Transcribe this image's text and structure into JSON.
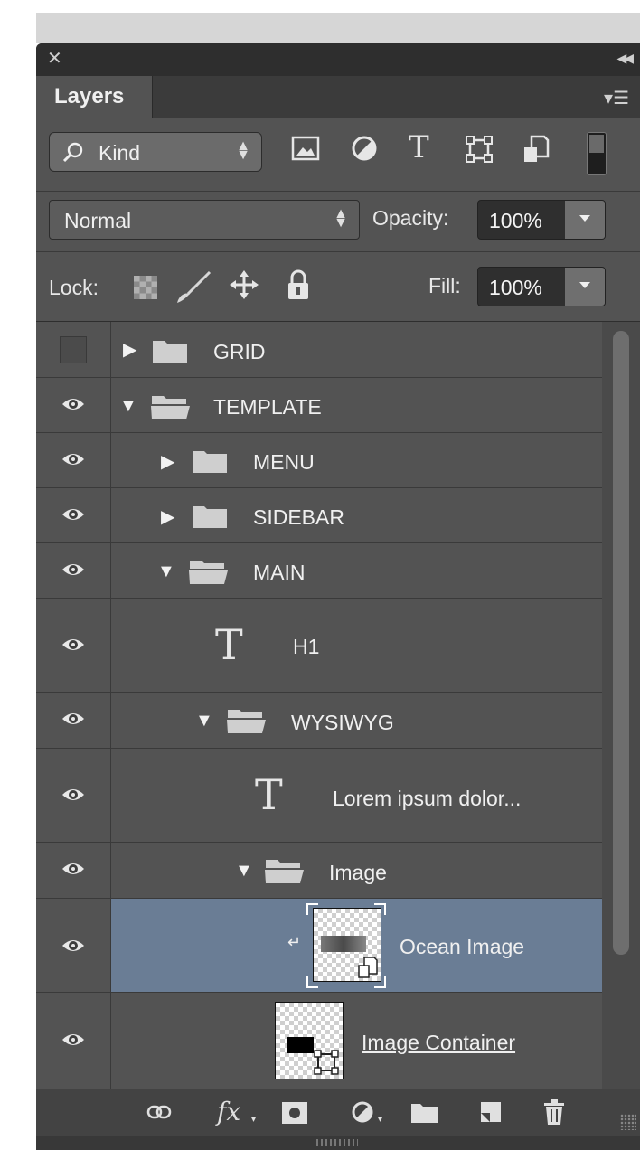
{
  "panel": {
    "close_icon": "close-icon",
    "collapse_icon": "double-chevron-left-icon",
    "tab_label": "Layers",
    "menu_icon": "panel-menu-icon"
  },
  "filter": {
    "kind_label": "Kind",
    "icons": [
      "image-filter-icon",
      "adjustment-filter-icon",
      "type-filter-icon",
      "shape-filter-icon",
      "smart-object-filter-icon"
    ],
    "type_filter_glyph": "T",
    "filter_toggle": "on-off-toggle"
  },
  "blend": {
    "mode": "Normal",
    "opacity_label": "Opacity:",
    "opacity_value": "100%",
    "lock_label": "Lock:",
    "fill_label": "Fill:",
    "fill_value": "100%"
  },
  "layers": [
    {
      "name": "GRID",
      "kind": "group",
      "expanded": false,
      "visible": false
    },
    {
      "name": "TEMPLATE",
      "kind": "group",
      "expanded": true,
      "visible": true
    },
    {
      "name": "MENU",
      "kind": "group",
      "expanded": false,
      "visible": true
    },
    {
      "name": "SIDEBAR",
      "kind": "group",
      "expanded": false,
      "visible": true
    },
    {
      "name": "MAIN",
      "kind": "group",
      "expanded": true,
      "visible": true
    },
    {
      "name": "H1",
      "kind": "text",
      "glyph": "T",
      "visible": true
    },
    {
      "name": "WYSIWYG",
      "kind": "group",
      "expanded": true,
      "visible": true
    },
    {
      "name": "Lorem ipsum dolor...",
      "kind": "text",
      "glyph": "T",
      "visible": true
    },
    {
      "name": "Image",
      "kind": "group",
      "expanded": true,
      "visible": true
    },
    {
      "name": "Ocean Image",
      "kind": "smart-object",
      "clipped": true,
      "selected": true,
      "visible": true
    },
    {
      "name": "Image Container",
      "kind": "shape",
      "visible": true
    }
  ],
  "toolbar": {
    "icons": [
      "link-layers-icon",
      "fx-icon",
      "add-mask-icon",
      "new-adjustment-icon",
      "new-group-icon",
      "new-layer-icon",
      "delete-icon"
    ],
    "fx_label": "fx"
  },
  "colors": {
    "panel_bg": "#535353",
    "selected_row": "#6a7d95",
    "field_dark": "#2f2f2f"
  }
}
